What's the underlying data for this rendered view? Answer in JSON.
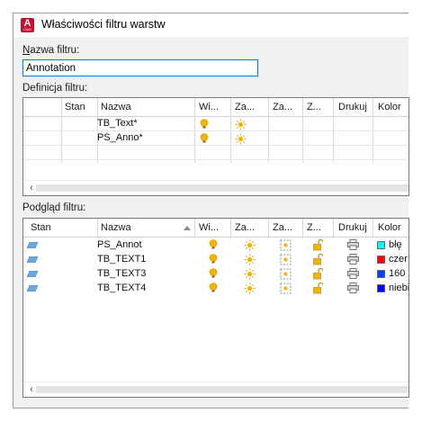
{
  "window": {
    "title": "Właściwości filtru warstw",
    "app_icon_letter": "A",
    "app_icon_sub": "CAD"
  },
  "filter_name": {
    "label": "Nazwa filtru:",
    "value": "Annotation"
  },
  "definition": {
    "label": "Definicja filtru:",
    "columns": [
      "Stan",
      "Nazwa",
      "Wi...",
      "Za...",
      "Za...",
      "Z...",
      "Drukuj",
      "Kolor"
    ],
    "rows": [
      {
        "name": "TB_Text*",
        "on_icon": "lightbulb-on-icon",
        "freeze_icon": "sun-icon"
      },
      {
        "name": "PS_Anno*",
        "on_icon": "lightbulb-on-icon",
        "freeze_icon": "sun-icon"
      }
    ]
  },
  "preview": {
    "label": "Podgląd filtru:",
    "columns": [
      "Stan",
      "Nazwa",
      "Wi...",
      "Za...",
      "Za...",
      "Z...",
      "Drukuj",
      "Kolor"
    ],
    "rows": [
      {
        "state_icon": "layer-icon",
        "name": "PS_Annot",
        "color_hex": "#00ffff",
        "color_name": "błę"
      },
      {
        "state_icon": "layer-icon",
        "name": "TB_TEXT1",
        "color_hex": "#ff0000",
        "color_name": "czer"
      },
      {
        "state_icon": "layer-icon",
        "name": "TB_TEXT3",
        "color_hex": "#0044ff",
        "color_name": "160"
      },
      {
        "state_icon": "layer-icon",
        "name": "TB_TEXT4",
        "color_hex": "#0000ff",
        "color_name": "niebi"
      }
    ]
  }
}
